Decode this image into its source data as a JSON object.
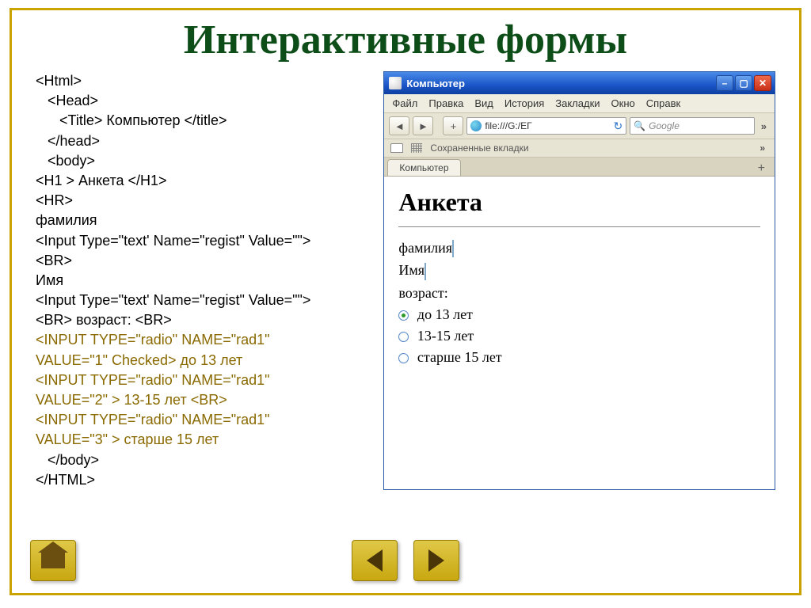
{
  "title": "Интерактивные формы",
  "code_lines": [
    "<Html>",
    "   <Head>",
    "      <Title> Компьютер </title>",
    "   </head>",
    "   <body>",
    "<H1 > Анкета </H1>",
    "<HR>",
    "фамилия",
    "<Input Type=\"text' Name=\"regist\" Value=\"\">",
    "<BR>",
    "Имя",
    "<Input Type=\"text' Name=\"regist\" Value=\"\">",
    "<BR> возраст: <BR>"
  ],
  "code_brown": [
    "<INPUT TYPE=\"radio\" NAME=\"rad1\"",
    "VALUE=\"1\" Checked> до 13 лет",
    "<INPUT TYPE=\"radio\" NAME=\"rad1\"",
    "VALUE=\"2\" > 13-15 лет <BR>",
    "<INPUT TYPE=\"radio\" NAME=\"rad1\"",
    "VALUE=\"3\" > старше 15 лет"
  ],
  "code_tail": [
    "   </body>",
    "</HTML>"
  ],
  "browser": {
    "window_title": "Компьютер",
    "menu": [
      "Файл",
      "Правка",
      "Вид",
      "История",
      "Закладки",
      "Окно",
      "Справк"
    ],
    "url": "file:///G:/ЕГ",
    "search_placeholder": "Google",
    "bookmark_label": "Сохраненные вкладки",
    "tab_label": "Компьютер",
    "page": {
      "heading": "Анкета",
      "surname_label": "фамилия",
      "name_label": "Имя",
      "age_label": "возраст:",
      "radios": [
        {
          "label": "до 13 лет",
          "checked": true
        },
        {
          "label": "13-15 лет",
          "checked": false
        },
        {
          "label": "старше 15 лет",
          "checked": false
        }
      ]
    }
  }
}
